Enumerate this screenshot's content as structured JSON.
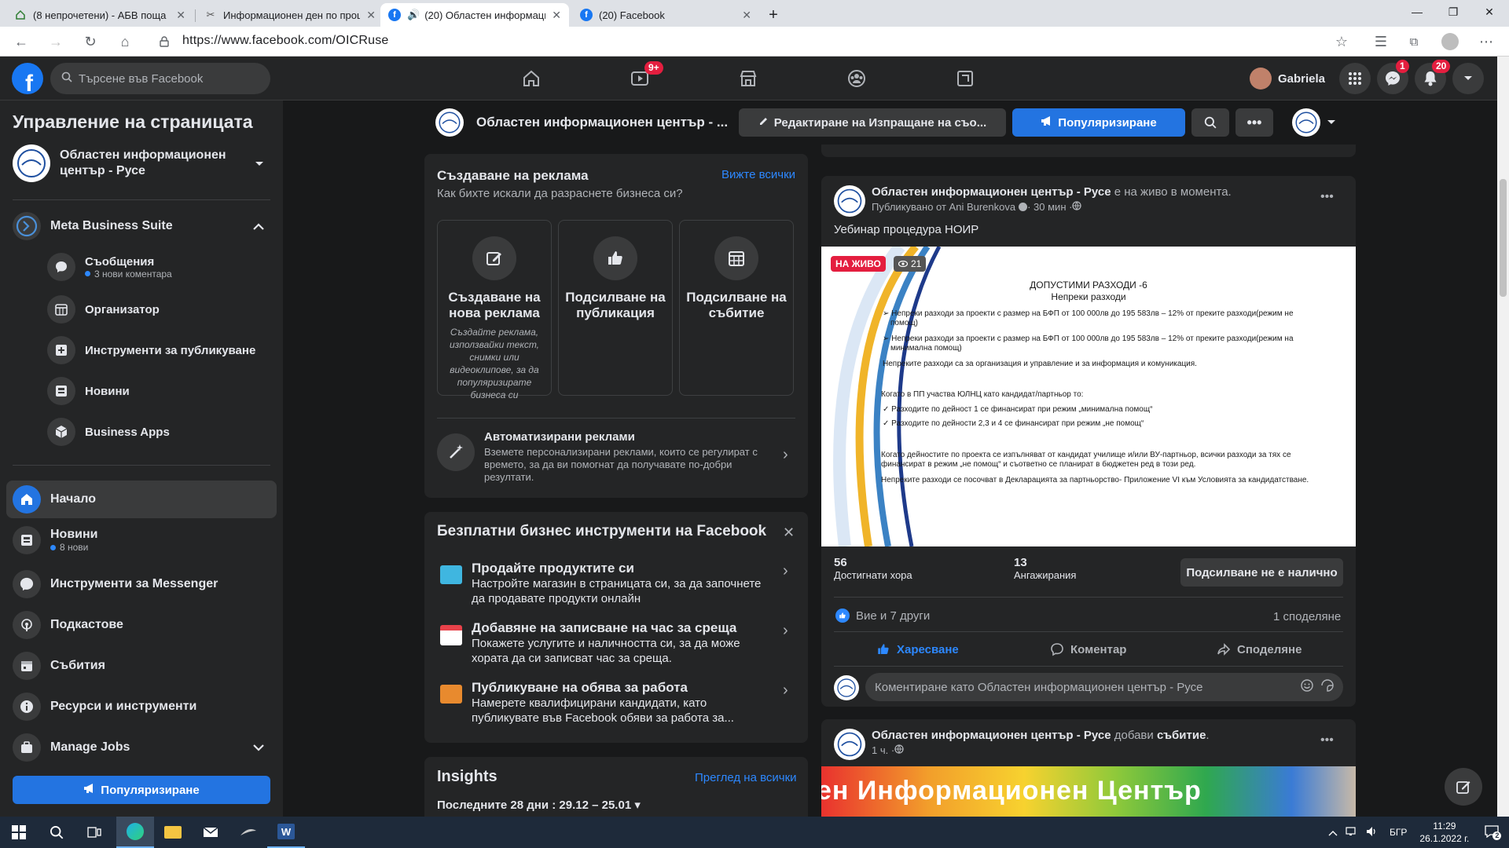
{
  "browser": {
    "tabs": [
      {
        "title": "(8 непрочетени) - АБВ поща",
        "active": false
      },
      {
        "title": "Информационен ден по проце...",
        "active": false
      },
      {
        "title": "(20) Областен информаци...",
        "active": true
      },
      {
        "title": "(20) Facebook",
        "active": false
      }
    ],
    "url": "https://www.facebook.com/OICRuse"
  },
  "fb_header": {
    "search_placeholder": "Търсене във Facebook",
    "watch_badge": "9+",
    "user_name": "Gabriela",
    "messenger_badge": "1",
    "notifications_badge": "20"
  },
  "sidebar": {
    "title": "Управление на страницата",
    "page_name": "Областен информационен център - Русе",
    "meta_suite": "Meta Business Suite",
    "suite_items": [
      {
        "label": "Съобщения",
        "sub": "3 нови коментара"
      },
      {
        "label": "Организатор",
        "sub": ""
      },
      {
        "label": "Инструменти за публикуване",
        "sub": ""
      },
      {
        "label": "Новини",
        "sub": ""
      },
      {
        "label": "Business Apps",
        "sub": ""
      }
    ],
    "nav_items": [
      {
        "label": "Начало",
        "sub": ""
      },
      {
        "label": "Новини",
        "sub": "8 нови"
      },
      {
        "label": "Инструменти за Messenger",
        "sub": ""
      },
      {
        "label": "Подкастове",
        "sub": ""
      },
      {
        "label": "Събития",
        "sub": ""
      },
      {
        "label": "Ресурси и инструменти",
        "sub": ""
      },
      {
        "label": "Manage Jobs",
        "sub": ""
      }
    ],
    "promote_button": "Популяризиране"
  },
  "page_bar": {
    "page_name": "Областен информационен център - ...",
    "edit_button": "Редактиране на Изпращане на съо...",
    "promote_button": "Популяризиране"
  },
  "ads_card": {
    "title": "Създаване на реклама",
    "see_all": "Вижте всички",
    "subtitle": "Как бихте искали да разраснете бизнеса си?",
    "tiles": [
      {
        "title": "Създаване на нова реклама",
        "desc": "Създайте реклама, използвайки текст, снимки или видеоклипове, за да популяризирате бизнеса си"
      },
      {
        "title": "Подсилване на публикация",
        "desc": ""
      },
      {
        "title": "Подсилване на събитие",
        "desc": ""
      }
    ],
    "auto_title": "Автоматизирани реклами",
    "auto_desc": "Вземете персонализирани реклами, които се регулират с времето, за да ви помогнат да получавате по-добри резултати."
  },
  "tools_card": {
    "title": "Безплатни бизнес инструменти на Facebook",
    "items": [
      {
        "title": "Продайте продуктите си",
        "desc": "Настройте магазин в страницата си, за да започнете да продавате продукти онлайн"
      },
      {
        "title": "Добавяне на записване на час за среща",
        "desc": "Покажете услугите и наличността си, за да може хората да си записват час за среща."
      },
      {
        "title": "Публикуване на обява за работа",
        "desc": "Намерете квалифицирани кандидати, като публикувате във Facebook обяви за работа за..."
      }
    ]
  },
  "insights": {
    "title": "Insights",
    "see_all": "Преглед на всички",
    "range": "Последните 28 дни : 29.12 – 25.01"
  },
  "post1": {
    "author": "Областен информационен център - Русе",
    "action": " е на живо в момента.",
    "meta": "Публикувано от Ani Burenkova",
    "time": " · 30 мин · ",
    "text": "Уебинар процедура НОИР",
    "live_label": "НА ЖИВО",
    "viewers": "21",
    "slide": {
      "title": "ДОПУСТИМИ РАЗХОДИ -6",
      "subtitle": "Непреки разходи",
      "lines": [
        "Непреки разходи за проекти с размер на БФП от 100 000лв до 195 583лв – 12% от преките разходи(режим не",
        "помощ)",
        "Непреки разходи за проекти с размер на БФП от 100 000лв до 195 583лв – 12% от преките разходи(режим на",
        "минимална помощ)",
        "Непреките разходи са за организация и управление и за информация и комуникация.",
        "Когато в ПП участва ЮЛНЦ като кандидат/партньор то:",
        "Разходите по дейност 1 се финансират при режим „минимална помощ“",
        "Разходите по дейности 2,3 и 4 се финансират при режим „не помощ“",
        "Когато дейностите по проекта се изпълняват от кандидат училище и/или ВУ-партньор, всички разходи за тях се",
        "финансират в режим „не помощ“ и съответно се планират в бюджетен ред в този ред.",
        "Непреките разходи се посочват в Декларацията за партньорство- Приложение VI  към Условията за кандидатстване."
      ]
    },
    "reach_value": "56",
    "reach_label": "Достигнати хора",
    "engagement_value": "13",
    "engagement_label": "Ангажирания",
    "boost_unavailable": "Подсилване не е налично",
    "reactions": "Вие и 7 други",
    "shares": "1 споделяне",
    "like": "Харесване",
    "comment": "Коментар",
    "share": "Споделяне",
    "comment_placeholder": "Коментиране като Областен информационен център - Русе"
  },
  "post2": {
    "author": "Областен информационен център - Русе",
    "action": " добави ",
    "action_bold": "събитие",
    "action_end": ".",
    "time": "1 ч. · ",
    "banner_text": "ен Информационен Център"
  },
  "taskbar": {
    "lang": "БГР",
    "time": "11:29",
    "date": "26.1.2022 г."
  },
  "colors": {
    "fb_blue": "#2374e1",
    "fb_bg": "#18191a",
    "card_bg": "#242526",
    "live_red": "#e41e3f"
  }
}
